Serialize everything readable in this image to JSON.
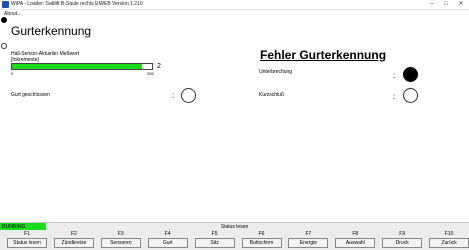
{
  "window": {
    "title": "WiPA - Loader: Sattlift B-Säule rechts EM/EB Version 1.210",
    "minimize_icon": "minimize-icon",
    "maximize_icon": "maximize-icon",
    "close_icon": "close-icon"
  },
  "menu": {
    "about": "About..."
  },
  "page": {
    "heading": "Gurterkennung",
    "sensor_label": "Hall-Sensor-Aktueller Meßwert",
    "unit_label": "[Inkremente]",
    "bar_min": "0",
    "bar_max": "255",
    "bar_value": "2",
    "bar_fill_fraction": 0.93,
    "belt_closed_label": "Gurt geschlossen",
    "colon": ":",
    "error_heading": "Fehler Gurterkennung",
    "interruption_label": "Unterbrechung",
    "short_circuit_label": "Kurzschluß",
    "belt_closed_state": "off",
    "interruption_state": "on",
    "short_circuit_state": "off"
  },
  "status": {
    "running": "RUNNING",
    "center": "Status lesen"
  },
  "fkeys": [
    {
      "key": "F1",
      "label": "Status lesen"
    },
    {
      "key": "F2",
      "label": "Zündkreise"
    },
    {
      "key": "F3",
      "label": "Sensoren"
    },
    {
      "key": "F4",
      "label": "Gurt"
    },
    {
      "key": "F5",
      "label": "Sitz"
    },
    {
      "key": "F6",
      "label": "Buttschirm"
    },
    {
      "key": "F7",
      "label": "Energie"
    },
    {
      "key": "F8",
      "label": "Auswahl"
    },
    {
      "key": "F9",
      "label": "Druck"
    },
    {
      "key": "F10",
      "label": "Zurück"
    }
  ],
  "colors": {
    "accent_green": "#1bdc1b",
    "indicator_on": "#000000",
    "indicator_off": "#ffffff"
  }
}
